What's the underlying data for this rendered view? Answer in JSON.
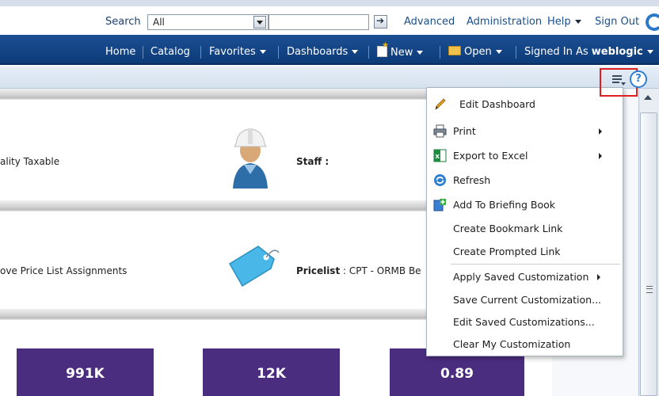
{
  "topbar": {
    "search_label": "Search",
    "scope_value": "All",
    "search_value": "",
    "advanced": "Advanced",
    "administration": "Administration",
    "help": "Help",
    "sign_out": "Sign Out"
  },
  "navbar": {
    "home": "Home",
    "catalog": "Catalog",
    "favorites": "Favorites",
    "dashboards": "Dashboards",
    "new": "New",
    "open": "Open",
    "signed_in_as_label": "Signed In As",
    "user": "weblogic"
  },
  "content": {
    "row1_left": "ality Taxable",
    "row1_right_label": "Staff",
    "row1_right_sep": " :",
    "row2_left": "ove Price List Assignments",
    "row2_right_label": "Pricelist",
    "row2_right_value": " : CPT - ORMB Be",
    "kpis": [
      "991K",
      "12K",
      "0.89"
    ]
  },
  "menu": {
    "items": [
      {
        "label": "Edit Dashboard",
        "icon": "pencil-icon"
      },
      {
        "label": "Print",
        "icon": "printer-icon",
        "submenu": true
      },
      {
        "label": "Export to Excel",
        "icon": "excel-icon",
        "submenu": true
      },
      {
        "label": "Refresh",
        "icon": "refresh-icon"
      },
      {
        "label": "Add To Briefing Book",
        "icon": "briefing-book-icon"
      },
      {
        "label": "Create Bookmark Link"
      },
      {
        "label": "Create Prompted Link"
      },
      {
        "label": "Apply Saved Customization",
        "submenu": true
      },
      {
        "label": "Save Current Customization..."
      },
      {
        "label": "Edit Saved Customizations..."
      },
      {
        "label": "Clear My Customization"
      }
    ]
  },
  "colors": {
    "navbar": "#0d3b78",
    "kpi_tile": "#4b2d7f",
    "highlight_border": "#e02020"
  }
}
